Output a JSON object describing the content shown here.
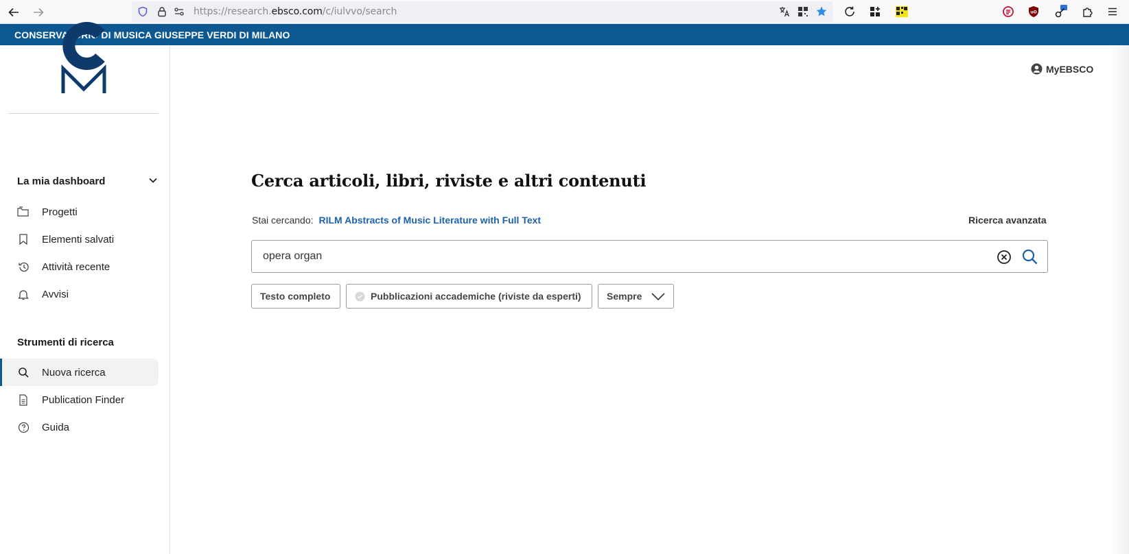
{
  "browser": {
    "url_prefix": "https://research.",
    "url_host": "ebsco.com",
    "url_path": "/c/iulvvo/search"
  },
  "institution": {
    "name": "CONSERVATORIO DI MUSICA GIUSEPPE VERDI DI MILANO"
  },
  "sidebar": {
    "dashboard_heading": "La mia dashboard",
    "dashboard_items": [
      {
        "label": "Progetti",
        "icon": "folder-icon"
      },
      {
        "label": "Elementi salvati",
        "icon": "bookmark-icon"
      },
      {
        "label": "Attività recente",
        "icon": "history-icon"
      },
      {
        "label": "Avvisi",
        "icon": "bell-icon"
      }
    ],
    "tools_heading": "Strumenti di ricerca",
    "tools_items": [
      {
        "label": "Nuova ricerca",
        "icon": "search-icon",
        "active": true
      },
      {
        "label": "Publication Finder",
        "icon": "document-icon"
      },
      {
        "label": "Guida",
        "icon": "help-icon"
      }
    ]
  },
  "header": {
    "account_label": "MyEBSCO"
  },
  "main": {
    "title": "Cerca articoli, libri, riviste e altri contenuti",
    "searching_label": "Stai cercando:",
    "database": "RILM Abstracts of Music Literature with Full Text",
    "advanced_search": "Ricerca avanzata",
    "search_value": "opera organ",
    "filters": {
      "full_text": "Testo completo",
      "peer_reviewed": "Pubblicazioni accademiche (riviste da esperti)",
      "date_range": "Sempre"
    }
  },
  "colors": {
    "brand_blue": "#0d5891",
    "link_blue": "#1d62a8"
  }
}
